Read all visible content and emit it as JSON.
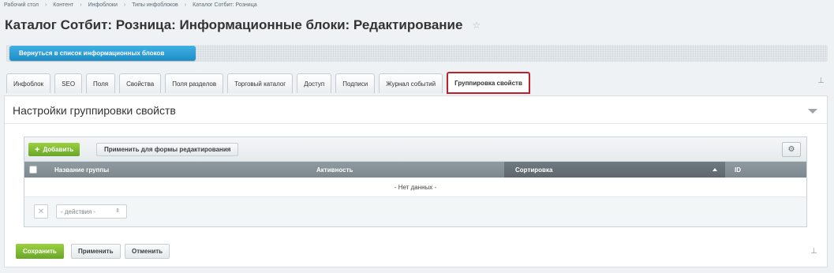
{
  "breadcrumbs": [
    "Рабочий стол",
    "Контент",
    "Инфоблоки",
    "Типы инфоблоков",
    "Каталог Сотбит: Розница"
  ],
  "breadcrumb_separator": "›",
  "page_title": "Каталог Сотбит: Розница: Информационные блоки: Редактирование",
  "star_icon": "☆",
  "back_button": "Вернуться в список информационных блоков",
  "tabs": [
    {
      "label": "Инфоблок"
    },
    {
      "label": "SEO"
    },
    {
      "label": "Поля"
    },
    {
      "label": "Свойства"
    },
    {
      "label": "Поля разделов"
    },
    {
      "label": "Торговый каталог"
    },
    {
      "label": "Доступ"
    },
    {
      "label": "Подписи"
    },
    {
      "label": "Журнал событий"
    },
    {
      "label": "Группировка свойств",
      "active": true
    }
  ],
  "section_title": "Настройки группировки свойств",
  "grid": {
    "add_button": "Добавить",
    "apply_form_button": "Применить для формы редактирования",
    "columns": [
      "Название группы",
      "Активность",
      "Сортировка",
      "ID"
    ],
    "sorted_column": "Сортировка",
    "no_data": "- Нет данных -",
    "actions_placeholder": "- действия -"
  },
  "footer": {
    "save": "Сохранить",
    "apply": "Применить",
    "cancel": "Отменить"
  },
  "colors": {
    "accent_blue": "#1e8dc6",
    "accent_green": "#6aa52b",
    "active_tab_border": "#c0202a"
  },
  "icons": {
    "add": "+",
    "settings": "⚙",
    "remove": "✕",
    "select_arrows": "⇕",
    "pin": "⊥"
  }
}
